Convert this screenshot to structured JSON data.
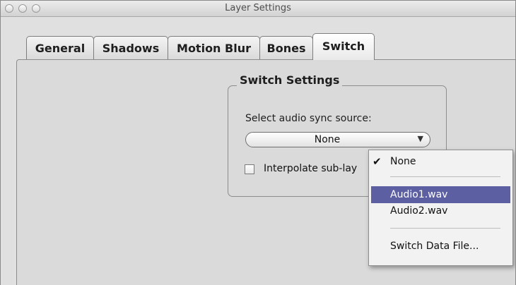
{
  "window": {
    "title": "Layer Settings"
  },
  "tabs": [
    {
      "label": "General"
    },
    {
      "label": "Shadows"
    },
    {
      "label": "Motion Blur"
    },
    {
      "label": "Bones"
    },
    {
      "label": "Switch",
      "active": true
    }
  ],
  "group": {
    "title": "Switch Settings",
    "audio_label": "Select audio sync source:",
    "audio_value": "None",
    "checkbox_label": "Interpolate sub-lay",
    "checkbox_checked": false
  },
  "menu": {
    "items": [
      {
        "label": "None",
        "checked": true
      },
      {
        "label": "Audio1.wav",
        "highlighted": true
      },
      {
        "label": "Audio2.wav"
      },
      {
        "label": "Switch Data File..."
      }
    ]
  },
  "colors": {
    "menu_highlight": "#5c5fa2"
  }
}
